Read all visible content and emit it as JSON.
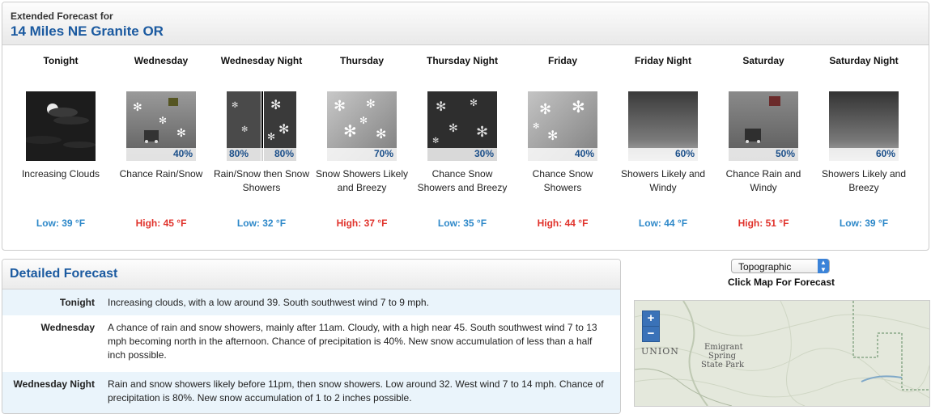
{
  "header": {
    "label": "Extended Forecast for",
    "location": "14 Miles NE Granite OR"
  },
  "periods": [
    {
      "name": "Tonight",
      "desc": "Increasing Clouds",
      "temp": "Low: 39 °F",
      "temp_type": "low",
      "icon": "night-increasing-clouds-icon",
      "pop": ""
    },
    {
      "name": "Wednesday",
      "desc": "Chance Rain/Snow",
      "temp": "High: 45 °F",
      "temp_type": "high",
      "icon": "rain-snow-icon",
      "pop": "40%"
    },
    {
      "name": "Wednesday Night",
      "desc": "Rain/Snow then Snow Showers",
      "temp": "Low: 32 °F",
      "temp_type": "low",
      "icon": "rain-snow-then-snow-icon",
      "pop_left": "80%",
      "pop_right": "80%"
    },
    {
      "name": "Thursday",
      "desc": "Snow Showers Likely and Breezy",
      "temp": "High: 37 °F",
      "temp_type": "high",
      "icon": "snow-showers-icon",
      "pop": "70%"
    },
    {
      "name": "Thursday Night",
      "desc": "Chance Snow Showers and Breezy",
      "temp": "Low: 35 °F",
      "temp_type": "low",
      "icon": "night-snow-showers-icon",
      "pop": "30%"
    },
    {
      "name": "Friday",
      "desc": "Chance Snow Showers",
      "temp": "High: 44 °F",
      "temp_type": "high",
      "icon": "snow-showers-icon",
      "pop": "40%"
    },
    {
      "name": "Friday Night",
      "desc": "Showers Likely and Windy",
      "temp": "Low: 44 °F",
      "temp_type": "low",
      "icon": "night-showers-icon",
      "pop": "60%"
    },
    {
      "name": "Saturday",
      "desc": "Chance Rain and Windy",
      "temp": "High: 51 °F",
      "temp_type": "high",
      "icon": "rain-icon",
      "pop": "50%"
    },
    {
      "name": "Saturday Night",
      "desc": "Showers Likely and Breezy",
      "temp": "Low: 39 °F",
      "temp_type": "low",
      "icon": "night-showers-icon",
      "pop": "60%"
    }
  ],
  "detailed": {
    "title": "Detailed Forecast",
    "rows": [
      {
        "label": "Tonight",
        "text": "Increasing clouds, with a low around 39. South southwest wind 7 to 9 mph."
      },
      {
        "label": "Wednesday",
        "text": "A chance of rain and snow showers, mainly after 11am. Cloudy, with a high near 45. South southwest wind 7 to 13 mph becoming north in the afternoon. Chance of precipitation is 40%. New snow accumulation of less than a half inch possible."
      },
      {
        "label": "Wednesday Night",
        "text": "Rain and snow showers likely before 11pm, then snow showers. Low around 32. West wind 7 to 14 mph. Chance of precipitation is 80%. New snow accumulation of 1 to 2 inches possible."
      }
    ]
  },
  "map": {
    "select_value": "Topographic",
    "caption": "Click Map For Forecast",
    "zoom_in": "+",
    "zoom_out": "−",
    "labels": {
      "union": "UNION",
      "park1": "Emigrant",
      "park2": "Spring",
      "park3": "State Park"
    }
  },
  "colors": {
    "low": "#2d88c9",
    "high": "#e0322b",
    "title": "#1b5aa0"
  }
}
